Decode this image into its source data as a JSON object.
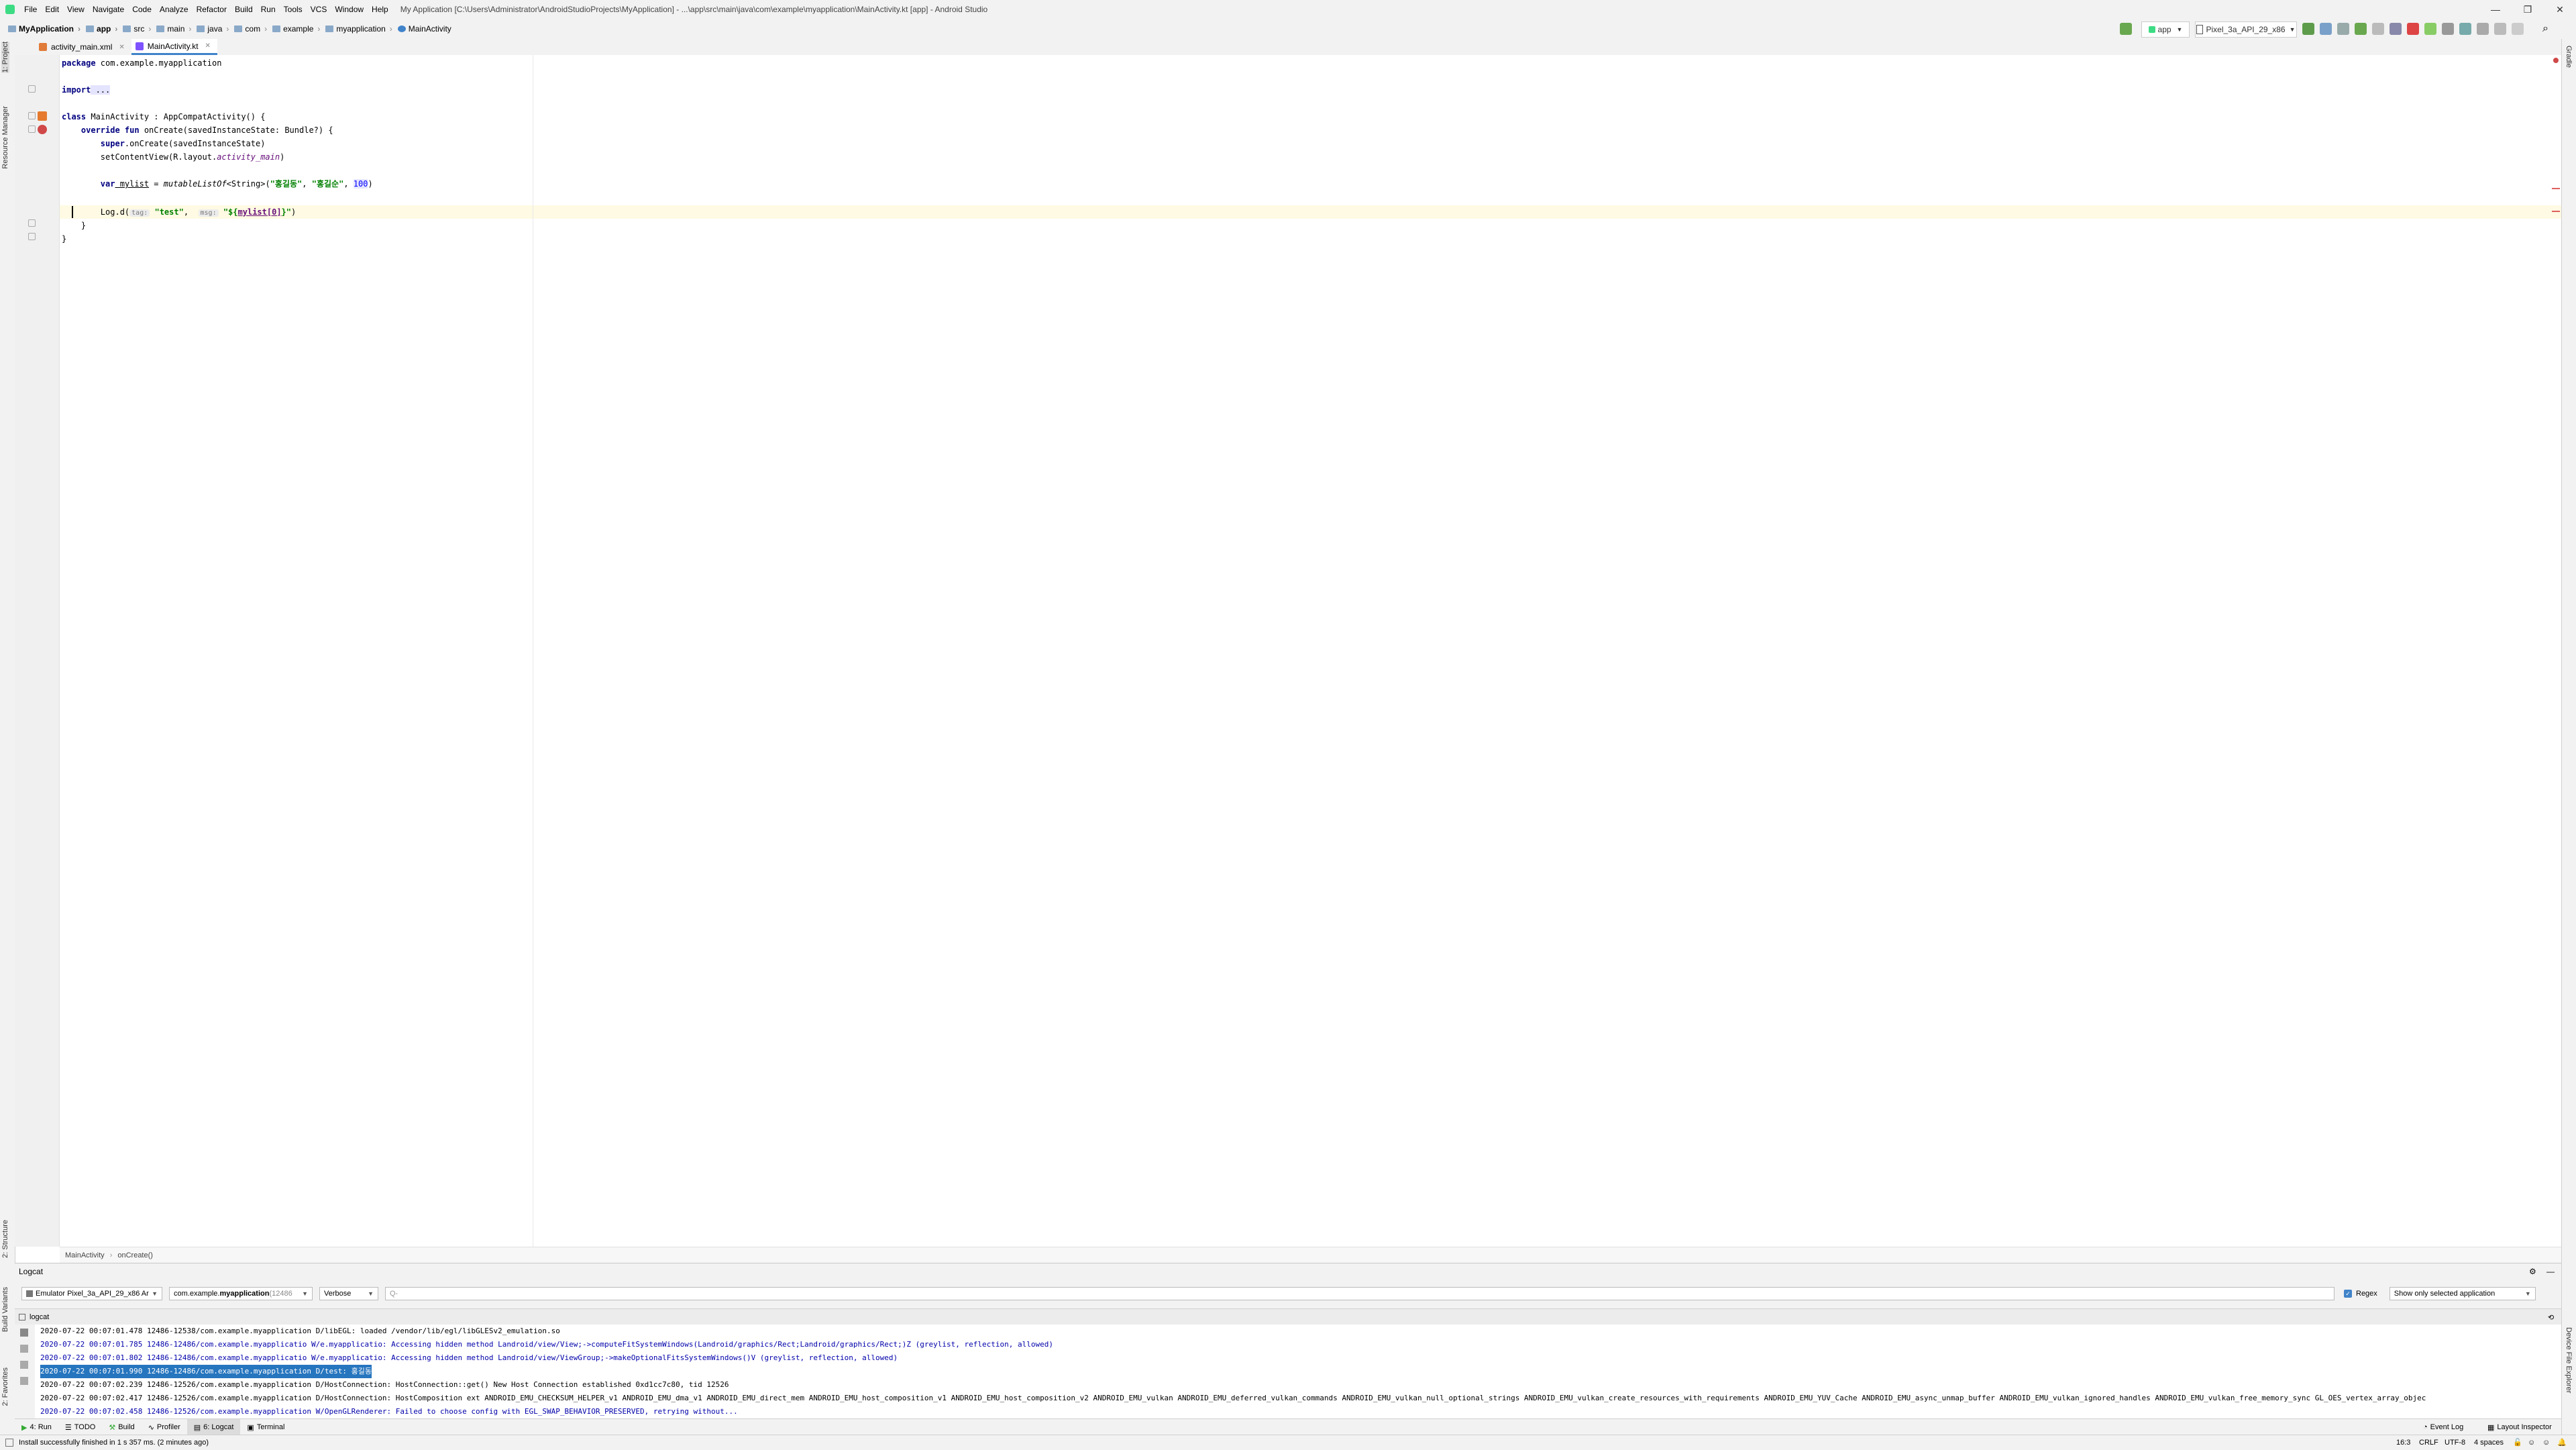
{
  "window": {
    "title": "My Application [C:\\Users\\Administrator\\AndroidStudioProjects\\MyApplication] - ...\\app\\src\\main\\java\\com\\example\\myapplication\\MainActivity.kt [app] - Android Studio",
    "controls": [
      "—",
      "❐",
      "✕"
    ]
  },
  "menu": [
    "File",
    "Edit",
    "View",
    "Navigate",
    "Code",
    "Analyze",
    "Refactor",
    "Build",
    "Run",
    "Tools",
    "VCS",
    "Window",
    "Help"
  ],
  "breadcrumb": [
    "MyApplication",
    "app",
    "src",
    "main",
    "java",
    "com",
    "example",
    "myapplication",
    "MainActivity"
  ],
  "toolbar": {
    "run_config": "app",
    "device": "Pixel_3a_API_29_x86"
  },
  "left_stripe": [
    "1: Project",
    "Resource Manager",
    "2: Structure",
    "Build Variants",
    "2: Favorites"
  ],
  "right_stripe": [
    "Gradle",
    "Device File Explorer"
  ],
  "tabs": [
    {
      "label": "activity_main.xml",
      "active": false
    },
    {
      "label": "MainActivity.kt",
      "active": true
    }
  ],
  "code": {
    "l1_kw": "package",
    "l1_rest": " com.example.myapplication",
    "l3_kw": "import",
    "l3_rest": " ...",
    "l6_kw": "class",
    "l6_rest": " MainActivity : AppCompatActivity() {",
    "l7_kw": "    override fun",
    "l7_rest": " onCreate(savedInstanceState: Bundle?) {",
    "l8_kw": "        super",
    "l8_rest": ".onCreate(savedInstanceState)",
    "l9_a": "        setContentView(R.layout.",
    "l9_b": "activity_main",
    "l9_c": ")",
    "l11_kw": "        var",
    "l11_var": " mylist",
    "l11_a": " = ",
    "l11_fn": "mutableListOf",
    "l11_b": "<String>(",
    "l11_s1": "\"홍길동\"",
    "l11_c": ", ",
    "l11_s2": "\"홍길순\"",
    "l11_d": ", ",
    "l11_n": "100",
    "l11_e": ")",
    "l13_a": "        Log.d(",
    "l13_h1": "tag:",
    "l13_s1": " \"test\"",
    "l13_b": ",  ",
    "l13_h2": "msg:",
    "l13_s2": " \"${",
    "l13_v": "mylist[0]",
    "l13_s3": "}\"",
    "l13_c": ")",
    "l14": "    }",
    "l15": "}"
  },
  "editor_breadcrumb": [
    "MainActivity",
    "onCreate()"
  ],
  "logcat": {
    "title": "Logcat",
    "device": "Emulator Pixel_3a_API_29_x86 Ar",
    "process_prefix": "com.example.",
    "process_bold": "myapplication",
    "process_pid": " (12486",
    "level": "Verbose",
    "search_placeholder": "Q-",
    "regex_label": "Regex",
    "filter": "Show only selected application",
    "subtab": "logcat",
    "lines": [
      {
        "text": "2020-07-22 00:07:01.478 12486-12538/com.example.myapplication D/libEGL: loaded /vendor/lib/egl/libGLESv2_emulation.so",
        "color": "#000000",
        "selected": false
      },
      {
        "text": "2020-07-22 00:07:01.785 12486-12486/com.example.myapplicatio W/e.myapplicatio: Accessing hidden method Landroid/view/View;->computeFitSystemWindows(Landroid/graphics/Rect;Landroid/graphics/Rect;)Z (greylist, reflection, allowed)",
        "color": "#0000aa",
        "selected": false
      },
      {
        "text": "2020-07-22 00:07:01.802 12486-12486/com.example.myapplicatio W/e.myapplicatio: Accessing hidden method Landroid/view/ViewGroup;->makeOptionalFitsSystemWindows()V (greylist, reflection, allowed)",
        "color": "#0000aa",
        "selected": false
      },
      {
        "text": "2020-07-22 00:07:01.990 12486-12486/com.example.myapplication D/test: 홍길동",
        "color": "#000000",
        "selected": true
      },
      {
        "text": "2020-07-22 00:07:02.239 12486-12526/com.example.myapplication D/HostConnection: HostConnection::get() New Host Connection established 0xd1cc7c80, tid 12526",
        "color": "#000000",
        "selected": false
      },
      {
        "text": "2020-07-22 00:07:02.417 12486-12526/com.example.myapplication D/HostConnection: HostComposition ext ANDROID_EMU_CHECKSUM_HELPER_v1 ANDROID_EMU_dma_v1 ANDROID_EMU_direct_mem ANDROID_EMU_host_composition_v1 ANDROID_EMU_host_composition_v2 ANDROID_EMU_vulkan ANDROID_EMU_deferred_vulkan_commands ANDROID_EMU_vulkan_null_optional_strings ANDROID_EMU_vulkan_create_resources_with_requirements ANDROID_EMU_YUV_Cache ANDROID_EMU_async_unmap_buffer ANDROID_EMU_vulkan_ignored_handles ANDROID_EMU_vulkan_free_memory_sync GL_OES_vertex_array_objec",
        "color": "#000000",
        "selected": false
      },
      {
        "text": "2020-07-22 00:07:02.458 12486-12526/com.example.myapplication W/OpenGLRenderer: Failed to choose config with EGL_SWAP_BEHAVIOR_PRESERVED, retrying without...",
        "color": "#0000aa",
        "selected": false
      }
    ]
  },
  "tool_tabs": [
    {
      "label": "4: Run",
      "active": false
    },
    {
      "label": "TODO",
      "active": false
    },
    {
      "label": "Build",
      "active": false
    },
    {
      "label": "Profiler",
      "active": false
    },
    {
      "label": "6: Logcat",
      "active": true
    },
    {
      "label": "Terminal",
      "active": false
    }
  ],
  "tool_tabs_right": [
    "Event Log",
    "Layout Inspector"
  ],
  "status": {
    "message": "Install successfully finished in 1 s 357 ms. (2 minutes ago)",
    "position": "16:3",
    "line_sep": "CRLF",
    "encoding": "UTF-8",
    "indent": "4 spaces"
  },
  "colors": {
    "accent": "#4083c9",
    "android_green": "#3ddc84",
    "selection": "#2675bf"
  }
}
